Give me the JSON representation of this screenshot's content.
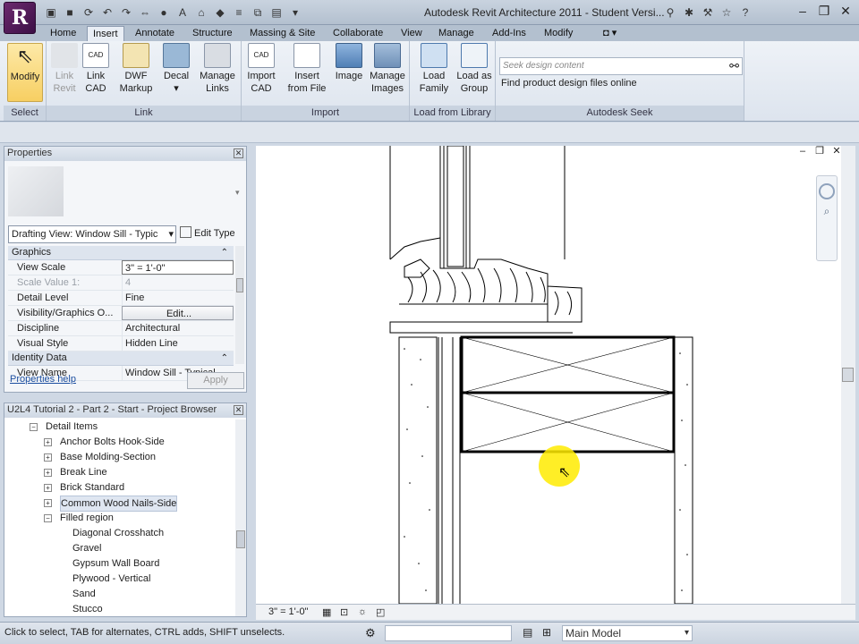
{
  "app": {
    "title": "Autodesk Revit Architecture 2011 - Student Versi...",
    "logo_letter": "R"
  },
  "qat": {
    "icons": [
      "open-icon",
      "save-icon",
      "sync-icon",
      "undo-icon",
      "redo-icon",
      "measure-icon",
      "tag-icon",
      "text-icon",
      "3d-view-icon",
      "section-icon",
      "thin-lines-icon",
      "close-hidden-icon",
      "switch-windows-icon",
      "dropdown-icon"
    ]
  },
  "window_buttons": {
    "minimize": "–",
    "restore": "❐",
    "close": "✕"
  },
  "tabs": [
    "Home",
    "Insert",
    "Annotate",
    "Structure",
    "Massing & Site",
    "Collaborate",
    "View",
    "Manage",
    "Add-Ins",
    "Modify"
  ],
  "active_tab": "Insert",
  "ribbon": {
    "select": {
      "button": "Modify",
      "panel": "Select"
    },
    "link": {
      "panel": "Link",
      "buttons": [
        [
          "Link",
          "Revit"
        ],
        [
          "Link",
          "CAD"
        ],
        [
          "DWF",
          "Markup"
        ],
        [
          "Decal",
          ""
        ],
        [
          "Manage",
          "Links"
        ]
      ]
    },
    "import": {
      "panel": "Import",
      "buttons": [
        [
          "Import",
          "CAD"
        ],
        [
          "Insert",
          "from File"
        ],
        [
          "Image",
          ""
        ],
        [
          "Manage",
          "Images"
        ]
      ]
    },
    "library": {
      "panel": "Load from Library",
      "buttons": [
        [
          "Load",
          "Family"
        ],
        [
          "Load as",
          "Group"
        ]
      ]
    },
    "seek": {
      "panel": "Autodesk Seek",
      "placeholder": "Seek design content",
      "link": "Find product design files online"
    }
  },
  "properties": {
    "title": "Properties",
    "type_selector": "Drafting View: Window Sill - Typic",
    "edit_type": "Edit Type",
    "groups": [
      {
        "name": "Graphics",
        "rows": [
          {
            "k": "View Scale",
            "v": "3\" = 1'-0\"",
            "style": "box"
          },
          {
            "k": "Scale Value    1:",
            "v": "4",
            "style": "dim"
          },
          {
            "k": "Detail Level",
            "v": "Fine",
            "style": ""
          },
          {
            "k": "Visibility/Graphics O...",
            "v": "Edit...",
            "style": "btn"
          },
          {
            "k": "Discipline",
            "v": "Architectural",
            "style": ""
          },
          {
            "k": "Visual Style",
            "v": "Hidden Line",
            "style": ""
          }
        ]
      },
      {
        "name": "Identity Data",
        "rows": [
          {
            "k": "View Name",
            "v": "Window Sill - Typical",
            "style": ""
          }
        ]
      }
    ],
    "help": "Properties help",
    "apply": "Apply"
  },
  "browser": {
    "title": "U2L4 Tutorial 2 - Part 2 - Start - Project Browser",
    "items": [
      {
        "label": "Detail Items",
        "level": 1,
        "toggle": "−",
        "selected": false
      },
      {
        "label": "Anchor Bolts Hook-Side",
        "level": 2,
        "toggle": "+",
        "selected": false
      },
      {
        "label": "Base Molding-Section",
        "level": 2,
        "toggle": "+",
        "selected": false
      },
      {
        "label": "Break Line",
        "level": 2,
        "toggle": "+",
        "selected": false
      },
      {
        "label": "Brick Standard",
        "level": 2,
        "toggle": "+",
        "selected": false
      },
      {
        "label": "Common Wood Nails-Side",
        "level": 2,
        "toggle": "+",
        "selected": true
      },
      {
        "label": "Filled region",
        "level": 2,
        "toggle": "−",
        "selected": false
      },
      {
        "label": "Diagonal Crosshatch",
        "level": 3,
        "toggle": "",
        "selected": false
      },
      {
        "label": "Gravel",
        "level": 3,
        "toggle": "",
        "selected": false
      },
      {
        "label": "Gypsum Wall Board",
        "level": 3,
        "toggle": "",
        "selected": false
      },
      {
        "label": "Plywood - Vertical",
        "level": 3,
        "toggle": "",
        "selected": false
      },
      {
        "label": "Sand",
        "level": 3,
        "toggle": "",
        "selected": false
      },
      {
        "label": "Stucco",
        "level": 3,
        "toggle": "",
        "selected": false
      }
    ]
  },
  "view_bar": {
    "scale": "3\" = 1'-0\""
  },
  "status": {
    "message": "Click to select, TAB for alternates, CTRL adds, SHIFT unselects.",
    "model": "Main Model"
  }
}
